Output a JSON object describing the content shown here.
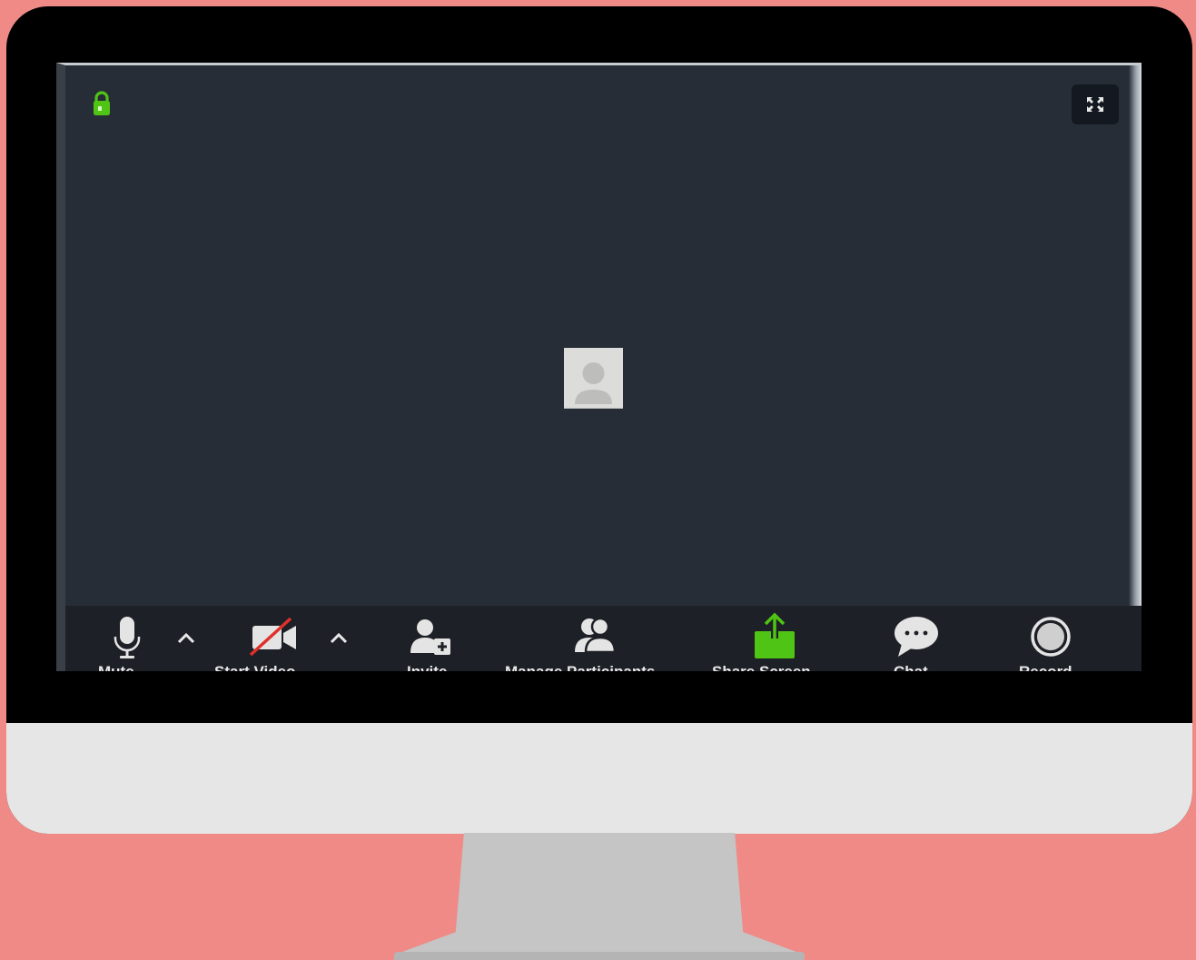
{
  "colors": {
    "background": "#ef8a87",
    "bezel": "#000000",
    "screen": "#262d36",
    "toolbar": "#1d2026",
    "accent_green": "#4fc414",
    "video_off_red": "#e0302a"
  },
  "meeting": {
    "lock_icon": "lock-icon",
    "fullscreen_icon": "fullscreen-icon",
    "participant_avatar_icon": "user-avatar-icon"
  },
  "toolbar": {
    "mute_label": "Mute",
    "start_video_label": "Start Video",
    "invite_label": "Invite",
    "manage_participants_label": "Manage Participants",
    "share_screen_label": "Share Screen",
    "chat_label": "Chat",
    "record_label": "Record"
  }
}
